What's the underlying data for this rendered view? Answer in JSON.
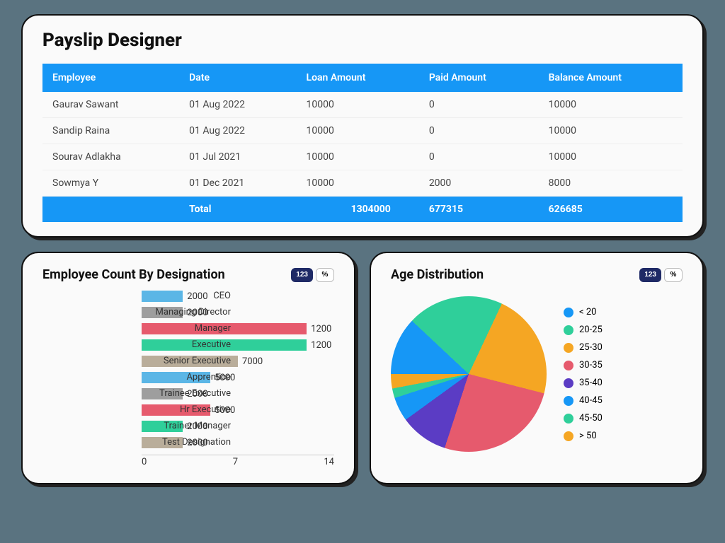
{
  "table": {
    "title": "Payslip Designer",
    "headers": [
      "Employee",
      "Date",
      "Loan Amount",
      "Paid Amount",
      "Balance Amount"
    ],
    "rows": [
      {
        "employee": "Gaurav Sawant",
        "date": "01 Aug 2022",
        "loan": "10000",
        "paid": "0",
        "balance": "10000"
      },
      {
        "employee": "Sandip Raina",
        "date": "01 Aug 2022",
        "loan": "10000",
        "paid": "0",
        "balance": "10000"
      },
      {
        "employee": "Sourav Adlakha",
        "date": "01 Jul 2021",
        "loan": "10000",
        "paid": "0",
        "balance": "10000"
      },
      {
        "employee": "Sowmya Y",
        "date": "01 Dec 2021",
        "loan": "10000",
        "paid": "2000",
        "balance": "8000"
      }
    ],
    "total_label": "Total",
    "totals": {
      "loan": "1304000",
      "paid": "677315",
      "balance": "626685"
    }
  },
  "toggle": {
    "count_label": "123",
    "percent_label": "%"
  },
  "barChart": {
    "title": "Employee Count By Designation",
    "x_ticks": [
      "0",
      "7",
      "14"
    ]
  },
  "pieChart": {
    "title": "Age Distribution"
  },
  "chart_data": [
    {
      "type": "bar",
      "title": "Employee Count By Designation",
      "xlabel": "",
      "ylabel": "",
      "xlim": [
        0,
        14
      ],
      "categories": [
        "CEO",
        "Managing Director",
        "Manager",
        "Executive",
        "Senior Executive",
        "Apprentice",
        "Trainee Executive",
        "Hr Executive",
        "Trainer Manager",
        "Test Designation"
      ],
      "bar_lengths": [
        3,
        3,
        12,
        12,
        7,
        5,
        3,
        5,
        3,
        3
      ],
      "data_labels": [
        "2000",
        "2000",
        "1200",
        "1200",
        "7000",
        "5000",
        "2000",
        "5000",
        "2000",
        "2000"
      ],
      "colors": [
        "#5bb6e6",
        "#9e9e9e",
        "#e65a6d",
        "#2fcf9a",
        "#b9ad9a",
        "#5bb6e6",
        "#9e9e9e",
        "#e65a6d",
        "#2fcf9a",
        "#b9ad9a"
      ]
    },
    {
      "type": "pie",
      "title": "Age Distribution",
      "series": [
        {
          "name": "< 20",
          "value": 12,
          "color": "#1697f6"
        },
        {
          "name": "20-25",
          "value": 20,
          "color": "#2fcf9a"
        },
        {
          "name": "25-30",
          "value": 22,
          "color": "#f5a623"
        },
        {
          "name": "30-35",
          "value": 26,
          "color": "#e65a6d"
        },
        {
          "name": "35-40",
          "value": 10,
          "color": "#5b3cc4"
        },
        {
          "name": "40-45",
          "value": 5,
          "color": "#1697f6"
        },
        {
          "name": "45-50",
          "value": 2,
          "color": "#2fcf9a"
        },
        {
          "name": "> 50",
          "value": 3,
          "color": "#f5a623"
        }
      ]
    }
  ]
}
